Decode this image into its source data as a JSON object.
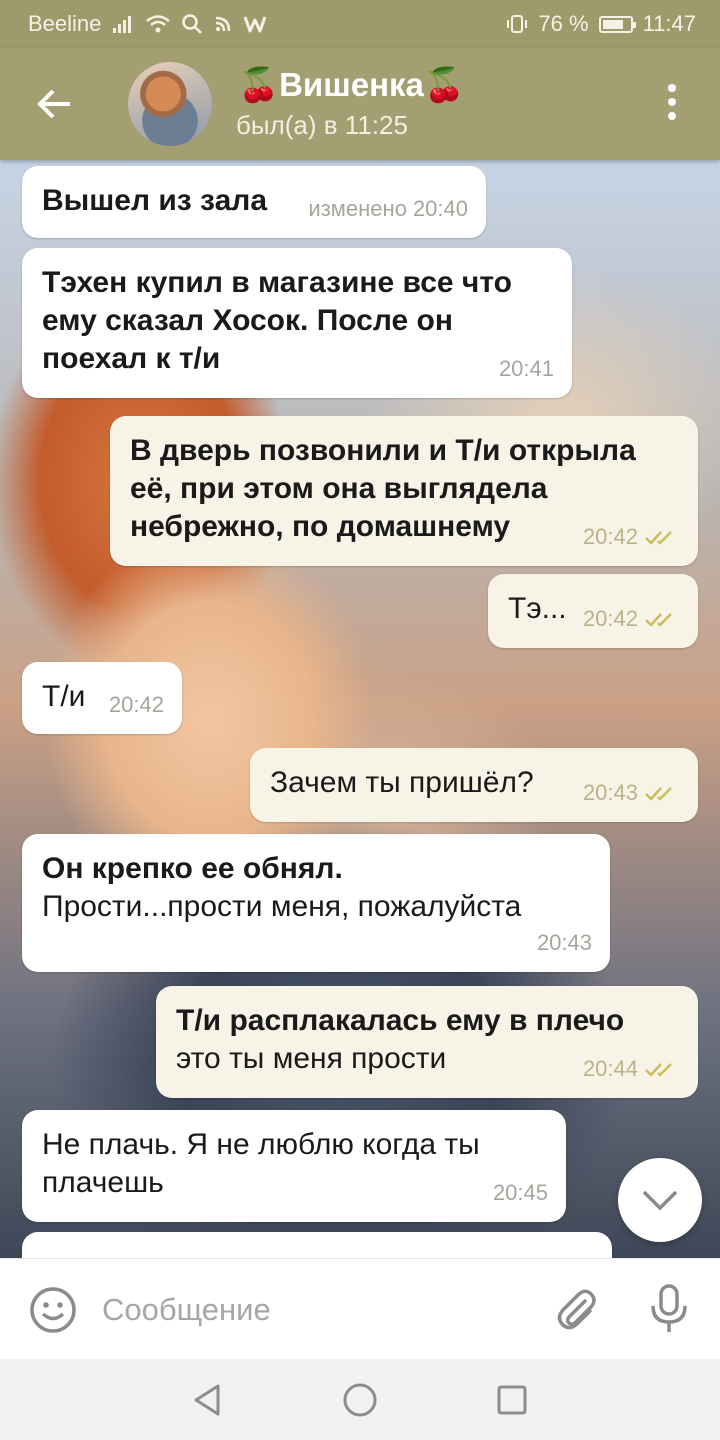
{
  "status_bar": {
    "carrier": "Beeline",
    "signal_icon": "signal-bars-icon",
    "wifi_icon": "wifi-icon",
    "battery_percent": "76 %",
    "battery_level": 0.76,
    "time": "11:47"
  },
  "header": {
    "back_icon": "arrow-left-icon",
    "title": "🍒Вишенка🍒",
    "status": "был(а) в 11:25",
    "menu_icon": "more-vertical-icon"
  },
  "messages": [
    {
      "side": "in",
      "text": "Вышел из зала",
      "bold": true,
      "edited": "изменено",
      "time": "20:40"
    },
    {
      "side": "in",
      "text": "Тэхен купил в магазине все что ему сказал Хосок. После он поехал к т/и",
      "bold": true,
      "time": "20:41"
    },
    {
      "side": "out",
      "text": "В дверь позвонили и Т/и открыла её, при этом она выглядела небрежно, по домашнему",
      "bold": true,
      "time": "20:42",
      "read": true
    },
    {
      "side": "out",
      "text": "Тэ...",
      "bold": false,
      "time": "20:42",
      "read": true
    },
    {
      "side": "in",
      "text": "Т/и",
      "bold": false,
      "time": "20:42"
    },
    {
      "side": "out",
      "text": "Зачем ты пришёл?",
      "bold": false,
      "time": "20:43",
      "read": true
    },
    {
      "side": "in",
      "text": "Он крепко ее обнял.",
      "text2": "Прости...прости меня, пожалуйста",
      "bold": true,
      "time": "20:43"
    },
    {
      "side": "out",
      "text": "Т/и расплакалась ему в плечо",
      "text2": "это ты меня прости",
      "bold": true,
      "time": "20:44",
      "read": true
    },
    {
      "side": "in",
      "text": "Не плачь. Я не люблю когда ты плачешь",
      "bold": false,
      "time": "20:45"
    }
  ],
  "input": {
    "placeholder": "Сообщение",
    "emoji_icon": "emoji-icon",
    "attach_icon": "paperclip-icon",
    "mic_icon": "microphone-icon"
  },
  "scroll_button_icon": "chevron-down-icon",
  "nav": {
    "back_icon": "nav-back-triangle-icon",
    "home_icon": "nav-home-circle-icon",
    "recents_icon": "nav-recents-square-icon"
  },
  "colors": {
    "header_bg": "#a39f73",
    "status_bg": "#9e9a6c",
    "bubble_out": "#f7f3e6",
    "bubble_in": "#ffffff",
    "check_color": "#c9bd5e"
  }
}
